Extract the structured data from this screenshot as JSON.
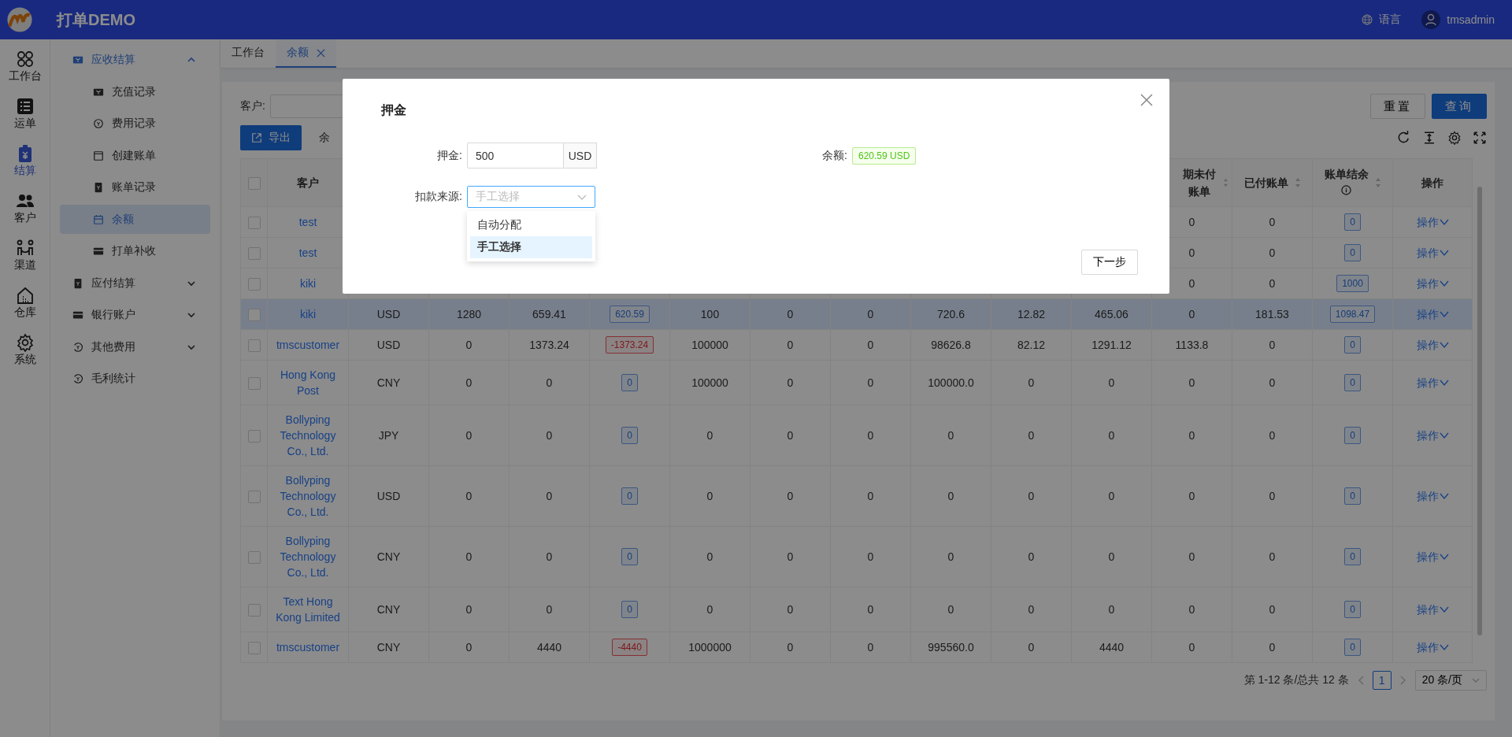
{
  "app": {
    "title": "打单DEMO",
    "language": "语言",
    "user": "tmsadmin"
  },
  "rail": [
    {
      "label": "工作台",
      "selected": false
    },
    {
      "label": "运单",
      "selected": false
    },
    {
      "label": "结算",
      "selected": true
    },
    {
      "label": "客户",
      "selected": false
    },
    {
      "label": "渠道",
      "selected": false
    },
    {
      "label": "仓库",
      "selected": false
    },
    {
      "label": "系统",
      "selected": false
    }
  ],
  "menu": [
    {
      "label": "应收结算",
      "expanded": true,
      "children": [
        {
          "label": "充值记录",
          "selected": false
        },
        {
          "label": "费用记录",
          "selected": false
        },
        {
          "label": "创建账单",
          "selected": false
        },
        {
          "label": "账单记录",
          "selected": false
        },
        {
          "label": "余额",
          "selected": true
        },
        {
          "label": "打单补收",
          "selected": false
        }
      ]
    },
    {
      "label": "应付结算",
      "expanded": false
    },
    {
      "label": "银行账户",
      "expanded": false
    },
    {
      "label": "其他费用",
      "expanded": false
    },
    {
      "label": "毛利统计"
    }
  ],
  "tabs": [
    {
      "label": "工作台",
      "selected": false,
      "closable": false
    },
    {
      "label": "余额",
      "selected": true,
      "closable": true
    }
  ],
  "filter": {
    "label": "客户:",
    "buttons": [
      {
        "label": "重置",
        "primary": false
      },
      {
        "label": "查询",
        "primary": true
      }
    ]
  },
  "toolbar": {
    "export": "导出",
    "summary": "余"
  },
  "table": {
    "select_all": {
      "checked": false
    },
    "columns": [
      {
        "label": "客户",
        "sortable": false
      },
      {},
      {},
      {},
      {},
      {},
      {},
      {},
      {},
      {},
      {},
      {
        "label": "期未付账单",
        "sortable": true
      },
      {
        "label": "已付账单",
        "sortable": true
      },
      {
        "label": "账单结余",
        "sortable": true,
        "info": true
      },
      {
        "label": "操作",
        "sortable": false
      }
    ],
    "rows": [
      {
        "checked": false,
        "highlighted": false,
        "cells": [
          {
            "kind": "link",
            "text": "test"
          },
          {
            "kind": "empty"
          },
          {
            "kind": "empty"
          },
          {
            "kind": "empty"
          },
          {
            "kind": "empty"
          },
          {
            "kind": "empty"
          },
          {
            "kind": "empty"
          },
          {
            "kind": "empty"
          },
          {
            "kind": "empty"
          },
          {
            "kind": "empty"
          },
          {
            "kind": "empty"
          },
          {
            "kind": "plain",
            "text": "0"
          },
          {
            "kind": "plain",
            "text": "0"
          },
          {
            "kind": "badge",
            "text": "0",
            "negative": false
          },
          {
            "kind": "action",
            "text": "操作"
          }
        ]
      },
      {
        "checked": false,
        "highlighted": false,
        "cells": [
          {
            "kind": "link",
            "text": "test"
          },
          {
            "kind": "empty"
          },
          {
            "kind": "empty"
          },
          {
            "kind": "empty"
          },
          {
            "kind": "empty"
          },
          {
            "kind": "empty"
          },
          {
            "kind": "empty"
          },
          {
            "kind": "empty"
          },
          {
            "kind": "empty"
          },
          {
            "kind": "empty"
          },
          {
            "kind": "empty"
          },
          {
            "kind": "plain",
            "text": "0"
          },
          {
            "kind": "plain",
            "text": "0"
          },
          {
            "kind": "badge",
            "text": "0",
            "negative": false
          },
          {
            "kind": "action",
            "text": "操作"
          }
        ]
      },
      {
        "checked": false,
        "highlighted": false,
        "cells": [
          {
            "kind": "link",
            "text": "kiki"
          },
          {
            "kind": "empty"
          },
          {
            "kind": "empty"
          },
          {
            "kind": "empty"
          },
          {
            "kind": "empty"
          },
          {
            "kind": "empty"
          },
          {
            "kind": "empty"
          },
          {
            "kind": "empty"
          },
          {
            "kind": "empty"
          },
          {
            "kind": "empty"
          },
          {
            "kind": "empty"
          },
          {
            "kind": "plain",
            "text": "0"
          },
          {
            "kind": "plain",
            "text": "0"
          },
          {
            "kind": "badge",
            "text": "1000",
            "negative": false
          },
          {
            "kind": "action",
            "text": "操作"
          }
        ]
      },
      {
        "checked": false,
        "highlighted": true,
        "cells": [
          {
            "kind": "link",
            "text": "kiki"
          },
          {
            "kind": "plain",
            "text": "USD"
          },
          {
            "kind": "plain",
            "text": "1280"
          },
          {
            "kind": "plain",
            "text": "659.41"
          },
          {
            "kind": "badge",
            "text": "620.59",
            "negative": false
          },
          {
            "kind": "plain",
            "text": "100"
          },
          {
            "kind": "plain",
            "text": "0"
          },
          {
            "kind": "plain",
            "text": "0"
          },
          {
            "kind": "plain",
            "text": "720.6"
          },
          {
            "kind": "plain",
            "text": "12.82"
          },
          {
            "kind": "plain",
            "text": "465.06"
          },
          {
            "kind": "plain",
            "text": "0"
          },
          {
            "kind": "plain",
            "text": "181.53"
          },
          {
            "kind": "badge",
            "text": "1098.47",
            "negative": false
          },
          {
            "kind": "action",
            "text": "操作"
          }
        ]
      },
      {
        "checked": false,
        "highlighted": false,
        "cells": [
          {
            "kind": "link",
            "text": "tmscustomer"
          },
          {
            "kind": "plain",
            "text": "USD"
          },
          {
            "kind": "plain",
            "text": "0"
          },
          {
            "kind": "plain",
            "text": "1373.24"
          },
          {
            "kind": "badge",
            "text": "-1373.24",
            "negative": true
          },
          {
            "kind": "plain",
            "text": "100000"
          },
          {
            "kind": "plain",
            "text": "0"
          },
          {
            "kind": "plain",
            "text": "0"
          },
          {
            "kind": "plain",
            "text": "98626.8"
          },
          {
            "kind": "plain",
            "text": "82.12"
          },
          {
            "kind": "plain",
            "text": "1291.12"
          },
          {
            "kind": "plain",
            "text": "1133.8"
          },
          {
            "kind": "plain",
            "text": "0"
          },
          {
            "kind": "badge",
            "text": "0",
            "negative": false
          },
          {
            "kind": "action",
            "text": "操作"
          }
        ]
      },
      {
        "checked": false,
        "highlighted": false,
        "cells": [
          {
            "kind": "link",
            "text": "Hong Kong Post"
          },
          {
            "kind": "plain",
            "text": "CNY"
          },
          {
            "kind": "plain",
            "text": "0"
          },
          {
            "kind": "plain",
            "text": "0"
          },
          {
            "kind": "badge",
            "text": "0",
            "negative": false
          },
          {
            "kind": "plain",
            "text": "100000"
          },
          {
            "kind": "plain",
            "text": "0"
          },
          {
            "kind": "plain",
            "text": "0"
          },
          {
            "kind": "plain",
            "text": "100000.0"
          },
          {
            "kind": "plain",
            "text": "0"
          },
          {
            "kind": "plain",
            "text": "0"
          },
          {
            "kind": "plain",
            "text": "0"
          },
          {
            "kind": "plain",
            "text": "0"
          },
          {
            "kind": "badge",
            "text": "0",
            "negative": false
          },
          {
            "kind": "action",
            "text": "操作"
          }
        ]
      },
      {
        "checked": false,
        "highlighted": false,
        "cells": [
          {
            "kind": "link",
            "text": "Bollyping Technology Co., Ltd."
          },
          {
            "kind": "plain",
            "text": "JPY"
          },
          {
            "kind": "plain",
            "text": "0"
          },
          {
            "kind": "plain",
            "text": "0"
          },
          {
            "kind": "badge",
            "text": "0",
            "negative": false
          },
          {
            "kind": "plain",
            "text": "0"
          },
          {
            "kind": "plain",
            "text": "0"
          },
          {
            "kind": "plain",
            "text": "0"
          },
          {
            "kind": "plain",
            "text": "0"
          },
          {
            "kind": "plain",
            "text": "0"
          },
          {
            "kind": "plain",
            "text": "0"
          },
          {
            "kind": "plain",
            "text": "0"
          },
          {
            "kind": "plain",
            "text": "0"
          },
          {
            "kind": "badge",
            "text": "0",
            "negative": false
          },
          {
            "kind": "action",
            "text": "操作"
          }
        ]
      },
      {
        "checked": false,
        "highlighted": false,
        "cells": [
          {
            "kind": "link",
            "text": "Bollyping Technology Co., Ltd."
          },
          {
            "kind": "plain",
            "text": "USD"
          },
          {
            "kind": "plain",
            "text": "0"
          },
          {
            "kind": "plain",
            "text": "0"
          },
          {
            "kind": "badge",
            "text": "0",
            "negative": false
          },
          {
            "kind": "plain",
            "text": "0"
          },
          {
            "kind": "plain",
            "text": "0"
          },
          {
            "kind": "plain",
            "text": "0"
          },
          {
            "kind": "plain",
            "text": "0"
          },
          {
            "kind": "plain",
            "text": "0"
          },
          {
            "kind": "plain",
            "text": "0"
          },
          {
            "kind": "plain",
            "text": "0"
          },
          {
            "kind": "plain",
            "text": "0"
          },
          {
            "kind": "badge",
            "text": "0",
            "negative": false
          },
          {
            "kind": "action",
            "text": "操作"
          }
        ]
      },
      {
        "checked": false,
        "highlighted": false,
        "cells": [
          {
            "kind": "link",
            "text": "Bollyping Technology Co., Ltd."
          },
          {
            "kind": "plain",
            "text": "CNY"
          },
          {
            "kind": "plain",
            "text": "0"
          },
          {
            "kind": "plain",
            "text": "0"
          },
          {
            "kind": "badge",
            "text": "0",
            "negative": false
          },
          {
            "kind": "plain",
            "text": "0"
          },
          {
            "kind": "plain",
            "text": "0"
          },
          {
            "kind": "plain",
            "text": "0"
          },
          {
            "kind": "plain",
            "text": "0"
          },
          {
            "kind": "plain",
            "text": "0"
          },
          {
            "kind": "plain",
            "text": "0"
          },
          {
            "kind": "plain",
            "text": "0"
          },
          {
            "kind": "plain",
            "text": "0"
          },
          {
            "kind": "badge",
            "text": "0",
            "negative": false
          },
          {
            "kind": "action",
            "text": "操作"
          }
        ]
      },
      {
        "checked": false,
        "highlighted": false,
        "cells": [
          {
            "kind": "link",
            "text": "Text Hong Kong Limited"
          },
          {
            "kind": "plain",
            "text": "CNY"
          },
          {
            "kind": "plain",
            "text": "0"
          },
          {
            "kind": "plain",
            "text": "0"
          },
          {
            "kind": "badge",
            "text": "0",
            "negative": false
          },
          {
            "kind": "plain",
            "text": "0"
          },
          {
            "kind": "plain",
            "text": "0"
          },
          {
            "kind": "plain",
            "text": "0"
          },
          {
            "kind": "plain",
            "text": "0"
          },
          {
            "kind": "plain",
            "text": "0"
          },
          {
            "kind": "plain",
            "text": "0"
          },
          {
            "kind": "plain",
            "text": "0"
          },
          {
            "kind": "plain",
            "text": "0"
          },
          {
            "kind": "badge",
            "text": "0",
            "negative": false
          },
          {
            "kind": "action",
            "text": "操作"
          }
        ]
      },
      {
        "checked": false,
        "highlighted": false,
        "cells": [
          {
            "kind": "link",
            "text": "tmscustomer"
          },
          {
            "kind": "plain",
            "text": "CNY"
          },
          {
            "kind": "plain",
            "text": "0"
          },
          {
            "kind": "plain",
            "text": "4440"
          },
          {
            "kind": "badge",
            "text": "-4440",
            "negative": true
          },
          {
            "kind": "plain",
            "text": "1000000"
          },
          {
            "kind": "plain",
            "text": "0"
          },
          {
            "kind": "plain",
            "text": "0"
          },
          {
            "kind": "plain",
            "text": "995560.0"
          },
          {
            "kind": "plain",
            "text": "0"
          },
          {
            "kind": "plain",
            "text": "4440"
          },
          {
            "kind": "plain",
            "text": "0"
          },
          {
            "kind": "plain",
            "text": "0"
          },
          {
            "kind": "badge",
            "text": "0",
            "negative": false
          },
          {
            "kind": "action",
            "text": "操作"
          }
        ]
      }
    ]
  },
  "pagination": {
    "summary": "第 1-12 条/总共 12 条",
    "pages": [
      {
        "label": "1",
        "selected": true
      }
    ],
    "page_size": "20 条/页"
  },
  "modal": {
    "title": "押金",
    "button": "下一步",
    "rows": [
      [
        {
          "kind": "addon-input",
          "label": "押金:",
          "value": "500",
          "addon": "USD"
        },
        {
          "kind": "tag",
          "label": "余额:",
          "value": "620.59 USD"
        }
      ],
      [
        {
          "kind": "select",
          "label": "扣款来源:",
          "placeholder": "手工选择",
          "open": true,
          "options": [
            {
              "label": "自动分配",
              "selected": false
            },
            {
              "label": "手工选择",
              "selected": true
            }
          ]
        }
      ]
    ]
  }
}
